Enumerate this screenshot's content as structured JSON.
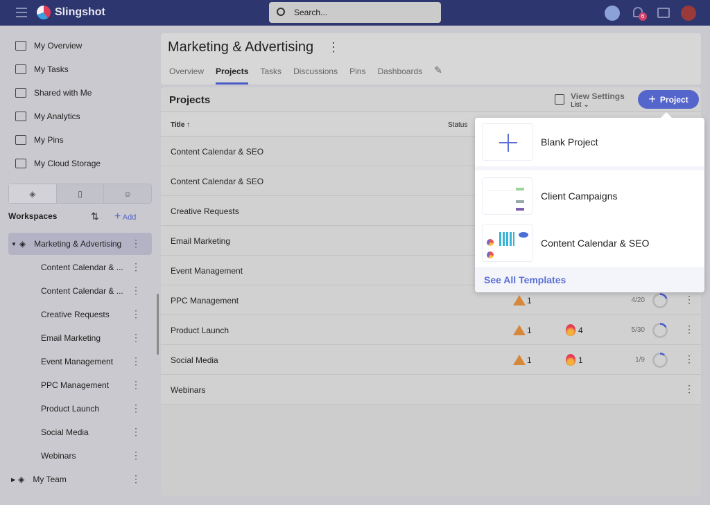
{
  "app": {
    "brand": "Slingshot",
    "search_placeholder": "Search...",
    "notification_count": "6"
  },
  "sidebar": {
    "items": [
      {
        "label": "My Overview",
        "icon": "activity-icon"
      },
      {
        "label": "My Tasks",
        "icon": "clipboard-check-icon"
      },
      {
        "label": "Shared with Me",
        "icon": "user-check-icon"
      },
      {
        "label": "My Analytics",
        "icon": "bar-chart-icon"
      },
      {
        "label": "My Pins",
        "icon": "pin-icon"
      },
      {
        "label": "My Cloud Storage",
        "icon": "cloud-icon"
      }
    ],
    "workspaces_label": "Workspaces",
    "add_label": "Add",
    "workspace": "Marketing & Advertising",
    "projects": [
      "Content Calendar & ...",
      "Content Calendar & ...",
      "Creative Requests",
      "Email Marketing",
      "Event Management",
      "PPC Management",
      "Product Launch",
      "Social Media",
      "Webinars"
    ],
    "team": "My Team"
  },
  "page": {
    "title": "Marketing & Advertising",
    "tabs": [
      "Overview",
      "Projects",
      "Tasks",
      "Discussions",
      "Pins",
      "Dashboards"
    ],
    "active_tab": "Projects"
  },
  "projects": {
    "heading": "Projects",
    "view_settings": "View Settings",
    "view_mode": "List",
    "new_button": "Project",
    "columns": {
      "title": "Title",
      "status": "Status"
    },
    "rows": [
      {
        "title": "Content Calendar & SEO"
      },
      {
        "title": "Content Calendar & SEO"
      },
      {
        "title": "Creative Requests"
      },
      {
        "title": "Email Marketing"
      },
      {
        "title": "Event Management"
      },
      {
        "title": "PPC Management",
        "warnings": "1",
        "progress": "4/20",
        "pct": 20
      },
      {
        "title": "Product Launch",
        "warnings": "1",
        "hot": "4",
        "progress": "5/30",
        "pct": 16.7
      },
      {
        "title": "Social Media",
        "warnings": "1",
        "hot": "1",
        "progress": "1/9",
        "pct": 11.1
      },
      {
        "title": "Webinars"
      }
    ]
  },
  "dropdown": {
    "options": [
      "Blank Project",
      "Client Campaigns",
      "Content Calendar & SEO"
    ],
    "see_all": "See All Templates"
  },
  "colors": {
    "accent": "#5465cc",
    "topbar": "#2e3670",
    "warning": "#d6873a"
  }
}
